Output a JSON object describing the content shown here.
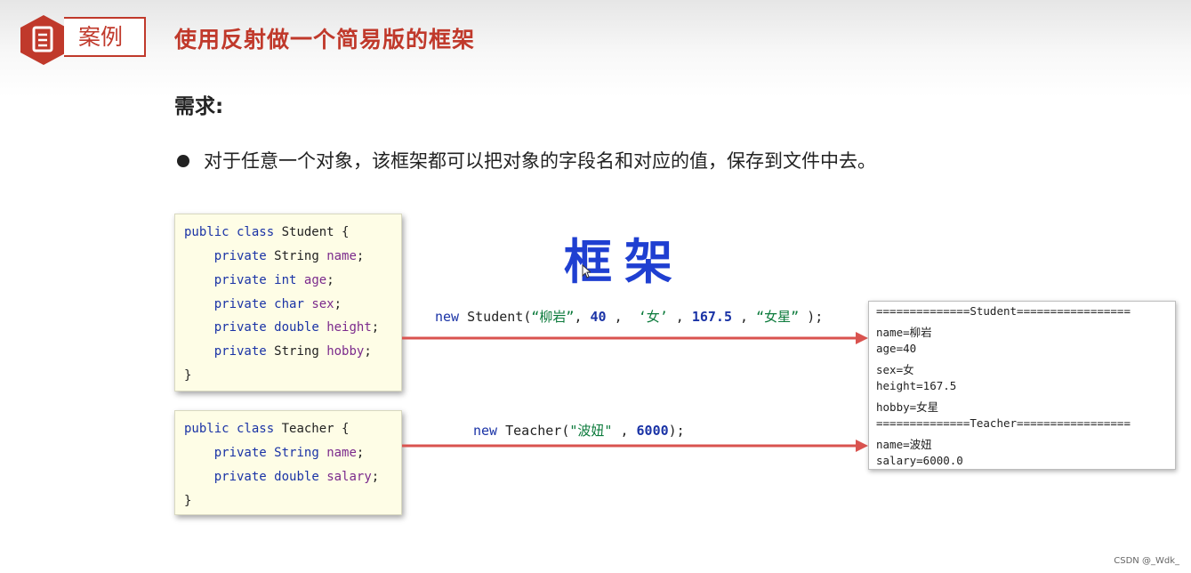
{
  "header": {
    "tag": "案例",
    "title": "使用反射做一个简易版的框架"
  },
  "requirement": {
    "label": "需求:",
    "bullet": "对于任意一个对象，该框架都可以把对象的字段名和对应的值，保存到文件中去。"
  },
  "student_class": {
    "line1_kw": "public class",
    "line1_name": "Student {",
    "fields": [
      {
        "kw": "private",
        "type": "String",
        "name": "name"
      },
      {
        "kw": "private",
        "type": "int",
        "name": "age"
      },
      {
        "kw": "private",
        "type": "char",
        "name": "sex"
      },
      {
        "kw": "private",
        "type": "double",
        "name": "height"
      },
      {
        "kw": "private",
        "type": "String",
        "name": "hobby"
      }
    ],
    "close": "}"
  },
  "teacher_class": {
    "line1_kw": "public class",
    "line1_name": "Teacher {",
    "fields": [
      {
        "kw": "private",
        "type": "String",
        "name": "name"
      },
      {
        "kw": "private",
        "type": "double",
        "name": "salary"
      }
    ],
    "close": "}"
  },
  "framework_label": "框架",
  "student_call": {
    "new": "new",
    "ctor": "Student(",
    "arg1": "“柳岩”",
    "arg2": "40",
    "arg3": "‘女’",
    "arg4": "167.5",
    "arg5": "“女星”",
    "end": ");"
  },
  "teacher_call": {
    "new": "new",
    "ctor": "Teacher(",
    "arg1": "\"波妞\"",
    "arg2": "6000",
    "end": ");"
  },
  "output_lines": [
    "==============Student=================",
    "name=柳岩",
    "age=40",
    "sex=女",
    "height=167.5",
    "hobby=女星",
    "==============Teacher=================",
    "name=波妞",
    "salary=6000.0"
  ],
  "watermark": "CSDN @_Wdk_",
  "colors": {
    "accent_red": "#c0392b",
    "keyword_blue": "#1a33a6",
    "framework_blue": "#1f3fd1",
    "string_green": "#0b7a3b",
    "arrow_red": "#d9534f"
  },
  "icons": [
    "document-icon",
    "cursor-icon"
  ]
}
